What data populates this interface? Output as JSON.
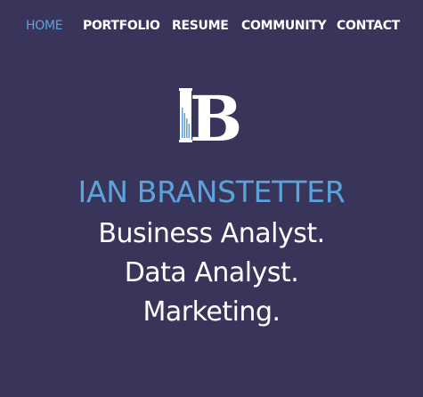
{
  "nav": {
    "items": [
      {
        "label": "HOME",
        "active": true
      },
      {
        "label": "PORTFOLIO",
        "active": false
      },
      {
        "label": "RESUME",
        "active": false
      },
      {
        "label": "COMMUNITY",
        "active": false
      },
      {
        "label": "CONTACT",
        "active": false
      }
    ]
  },
  "logo": {
    "letter": "B",
    "icon": "ib-monogram-logo-icon"
  },
  "hero": {
    "name": "IAN BRANSTETTER",
    "roles": [
      "Business Analyst.",
      "Data Analyst.",
      "Marketing."
    ]
  },
  "colors": {
    "background": "#39355a",
    "accent": "#5ba3dd",
    "text": "#ffffff"
  }
}
